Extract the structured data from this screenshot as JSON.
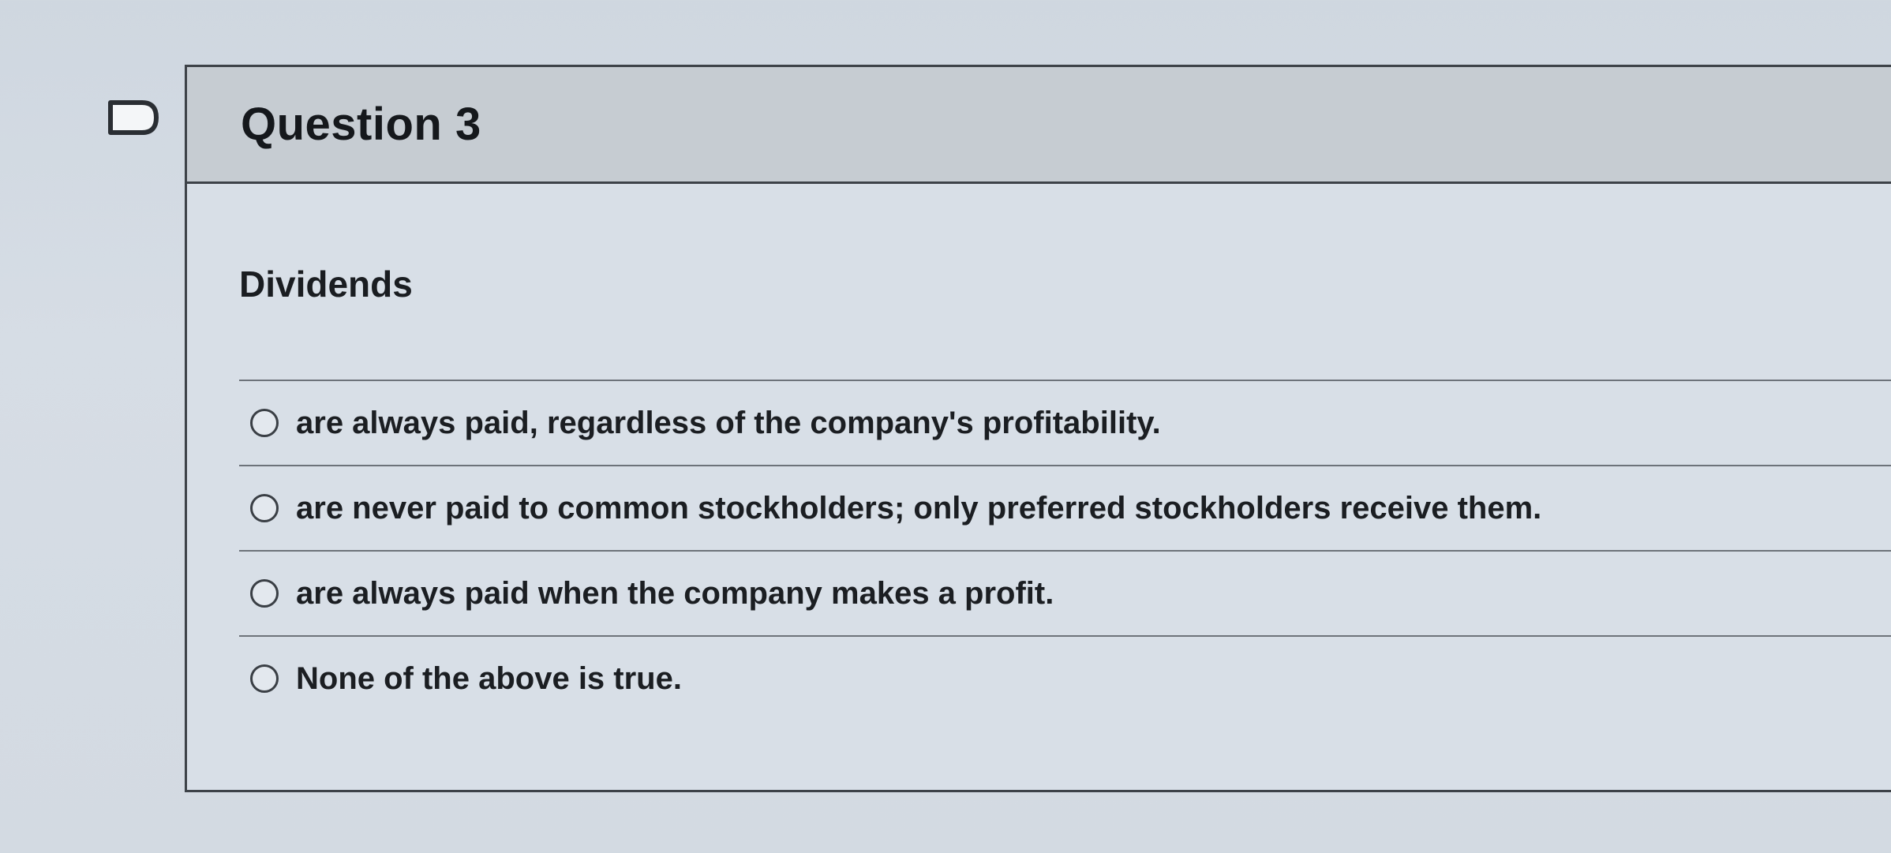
{
  "flag": {
    "icon": "flag-icon"
  },
  "question": {
    "title": "Question 3",
    "prompt": "Dividends",
    "answers": [
      {
        "label": "are always paid, regardless of the company's profitability.",
        "selected": false
      },
      {
        "label": "are never paid to common stockholders; only preferred stockholders receive them.",
        "selected": false
      },
      {
        "label": "are always paid when the company makes a profit.",
        "selected": false
      },
      {
        "label": "None of the above is true.",
        "selected": false
      }
    ]
  }
}
